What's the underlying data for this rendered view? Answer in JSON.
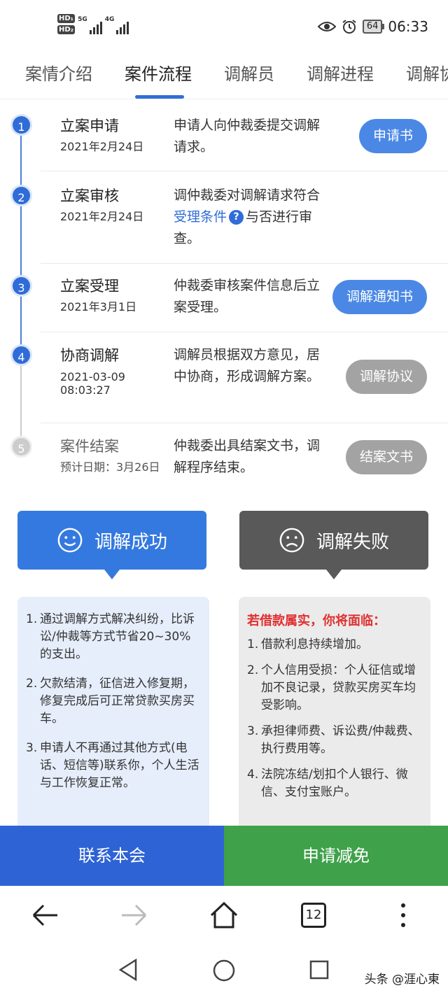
{
  "status_bar": {
    "hd1": "HD₁",
    "hd2": "HD₂",
    "net1": "5G",
    "net2": "4G",
    "battery": "64",
    "time": "06:33"
  },
  "tabs": [
    "案情介绍",
    "案件流程",
    "调解员",
    "调解进程",
    "调解协"
  ],
  "steps": [
    {
      "num": "1",
      "title": "立案申请",
      "date": "2021年2月24日",
      "desc": "申请人向仲裁委提交调解请求。",
      "button": "申请书"
    },
    {
      "num": "2",
      "title": "立案审核",
      "date": "2021年2月24日",
      "desc_before": "调仲裁委对调解请求符合",
      "desc_link": "受理条件",
      "desc_after": "与否进行审查。"
    },
    {
      "num": "3",
      "title": "立案受理",
      "date": "2021年3月1日",
      "desc": "仲裁委审核案件信息后立案受理。",
      "button": "调解通知书"
    },
    {
      "num": "4",
      "title": "协商调解",
      "date": "2021-03-09 08:03:27",
      "desc": "调解员根据双方意见，居中协商，形成调解方案。",
      "button": "调解协议"
    },
    {
      "num": "5",
      "title": "案件结案",
      "date": "预计日期：3月26日",
      "desc": "仲裁委出具结案文书，调解程序结束。",
      "button": "结案文书"
    }
  ],
  "success": {
    "label": "调解成功",
    "items": [
      {
        "n": "1.",
        "text": "通过调解方式解决纠纷，比诉讼/仲裁等方式节省20~30%的支出。"
      },
      {
        "n": "2.",
        "text": "欠款结清，征信进入修复期，修复完成后可正常贷款买房买车。"
      },
      {
        "n": "3.",
        "text": "申请人不再通过其他方式(电话、短信等)联系你，个人生活与工作恢复正常。"
      }
    ]
  },
  "failure": {
    "label": "调解失败",
    "head": "若借款属实，你将面临：",
    "items": [
      {
        "n": "1.",
        "text": "借款利息持续增加。"
      },
      {
        "n": "2.",
        "text": "个人信用受损：个人征信或增加不良记录，贷款买房买车均受影响。"
      },
      {
        "n": "3.",
        "text": "承担律师费、诉讼费/仲裁费、执行费用等。"
      },
      {
        "n": "4.",
        "text": "法院冻结/划扣个人银行、微信、支付宝账户。"
      }
    ]
  },
  "actions": {
    "contact": "联系本会",
    "apply": "申请减免"
  },
  "browser": {
    "tab_count": "12"
  },
  "watermark": "头条 @涯心東",
  "colors": {
    "primary": "#2f6cd7",
    "success_btn": "#3479df",
    "fail_btn": "#595959",
    "apply": "#3fa14a",
    "warning_text": "#e03030"
  }
}
